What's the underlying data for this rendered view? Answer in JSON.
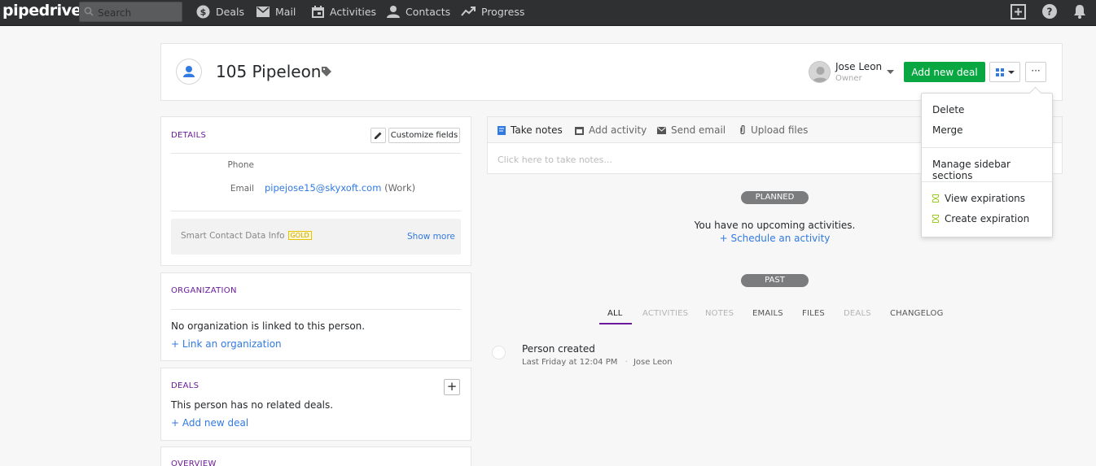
{
  "topbar": {
    "logo": "pipedrive",
    "search_placeholder": "Search",
    "nav": [
      "Deals",
      "Mail",
      "Activities",
      "Contacts",
      "Progress"
    ]
  },
  "header": {
    "person_name": "105 Pipeleon",
    "owner_name": "Jose Leon",
    "owner_role": "Owner",
    "add_deal_label": "Add new deal",
    "more_label": "···"
  },
  "menu": {
    "delete": "Delete",
    "merge": "Merge",
    "manage": "Manage sidebar sections",
    "view_exp": "View expirations",
    "create_exp": "Create expiration"
  },
  "details": {
    "title": "DETAILS",
    "customize": "Customize fields",
    "phone_label": "Phone",
    "email_label": "Email",
    "email_value": "pipejose15@skyxoft.com",
    "email_type": "(Work)",
    "smart_label": "Smart Contact Data Info",
    "gold": "GOLD",
    "show_more": "Show more"
  },
  "organization": {
    "title": "ORGANIZATION",
    "empty_text": "No organization is linked to this person.",
    "link": "+ Link an organization"
  },
  "deals": {
    "title": "DEALS",
    "plus": "+",
    "empty_text": "This person has no related deals.",
    "link": "+ Add new deal"
  },
  "overview": {
    "title": "OVERVIEW"
  },
  "notes": {
    "tabs": [
      "Take notes",
      "Add activity",
      "Send email",
      "Upload files"
    ],
    "placeholder": "Click here to take notes..."
  },
  "timeline": {
    "planned": "PLANNED",
    "no_activities": "You have no upcoming activities.",
    "schedule": "+ Schedule an activity",
    "past": "PAST",
    "filters": [
      "ALL",
      "ACTIVITIES",
      "NOTES",
      "EMAILS",
      "FILES",
      "DEALS",
      "CHANGELOG"
    ],
    "event_title": "Person created",
    "event_time": "Last Friday at 12:04 PM",
    "event_sep": "·",
    "event_user": "Jose Leon"
  },
  "colors": {
    "topbar": "#2f3032",
    "accent_green": "#08a742",
    "link": "#317ae2",
    "section_title": "#6a1b9a"
  }
}
